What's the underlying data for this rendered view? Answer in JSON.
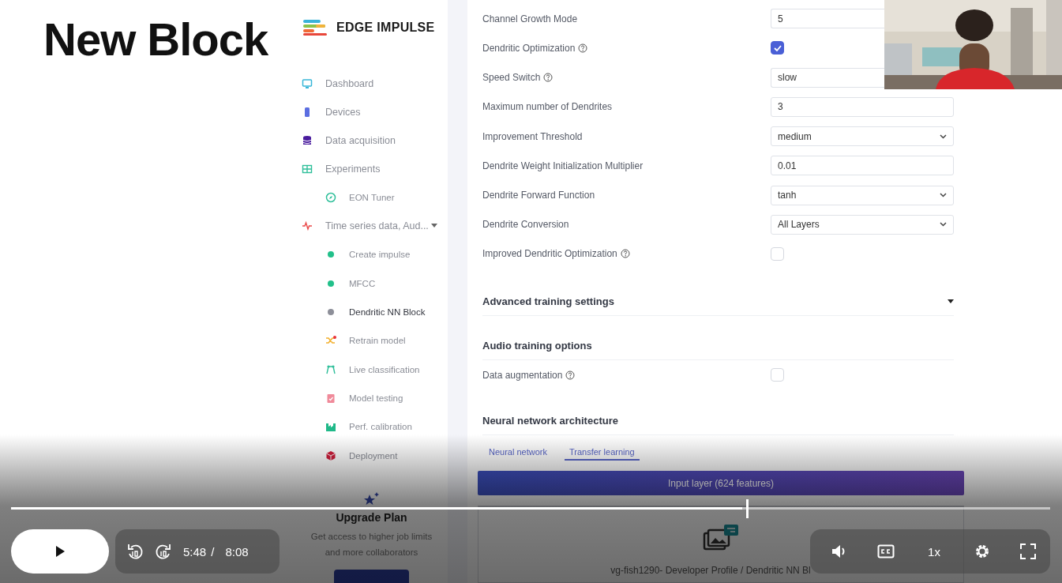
{
  "video_title": "New Block",
  "brand": {
    "name": "EDGE IMPULSE"
  },
  "sidebar": {
    "items": [
      {
        "label": "Dashboard",
        "selected": false,
        "expanded": false
      },
      {
        "label": "Devices",
        "selected": false,
        "expanded": false
      },
      {
        "label": "Data acquisition",
        "selected": false,
        "expanded": false
      },
      {
        "label": "Experiments",
        "selected": false,
        "expanded": false,
        "children": [
          {
            "label": "EON Tuner",
            "selected": false
          }
        ]
      },
      {
        "label": "Time series data, Aud...",
        "selected": false,
        "expanded": true,
        "children": [
          {
            "label": "Create impulse",
            "selected": false
          },
          {
            "label": "MFCC",
            "selected": false
          },
          {
            "label": "Dendritic NN Block",
            "selected": true
          },
          {
            "label": "Retrain model",
            "selected": false
          },
          {
            "label": "Live classification",
            "selected": false
          },
          {
            "label": "Model testing",
            "selected": false
          },
          {
            "label": "Perf. calibration",
            "selected": false
          },
          {
            "label": "Deployment",
            "selected": false
          }
        ]
      }
    ]
  },
  "upgrade": {
    "title": "Upgrade Plan",
    "text": "Get access to higher job limits and more collaborators"
  },
  "settings": [
    {
      "label": "Channel Growth Mode",
      "help": false,
      "kind": "input",
      "value": "5"
    },
    {
      "label": "Dendritic Optimization",
      "help": true,
      "kind": "checkbox",
      "checked": true
    },
    {
      "label": "Speed Switch",
      "help": true,
      "kind": "input",
      "value": "slow"
    },
    {
      "label": "Maximum number of Dendrites",
      "help": false,
      "kind": "input",
      "value": "3"
    },
    {
      "label": "Improvement Threshold",
      "help": false,
      "kind": "select",
      "value": "medium"
    },
    {
      "label": "Dendrite Weight Initialization Multiplier",
      "help": false,
      "kind": "input",
      "value": "0.01"
    },
    {
      "label": "Dendrite Forward Function",
      "help": false,
      "kind": "select",
      "value": "tanh"
    },
    {
      "label": "Dendrite Conversion",
      "help": false,
      "kind": "select",
      "value": "All Layers"
    },
    {
      "label": "Improved Dendritic Optimization",
      "help": true,
      "kind": "checkbox",
      "checked": false
    }
  ],
  "advanced": {
    "title": "Advanced training settings",
    "expanded": false
  },
  "audio": {
    "title": "Audio training options",
    "settings": [
      {
        "label": "Data augmentation",
        "help": true,
        "kind": "checkbox",
        "checked": false
      }
    ]
  },
  "architecture": {
    "title": "Neural network architecture",
    "tabs": [
      {
        "label": "Neural network",
        "selected": false
      },
      {
        "label": "Transfer learning",
        "selected": true
      }
    ],
    "input_layer": "Input layer (624 features)",
    "block": {
      "text": "vg-fish1290- Developer Profile / Dendritic NN Bl"
    }
  },
  "player": {
    "playing": false,
    "progress": {
      "level": 0.704
    },
    "current_time": "5:48",
    "separator": "/",
    "duration": "8:08",
    "speed": "1x"
  }
}
